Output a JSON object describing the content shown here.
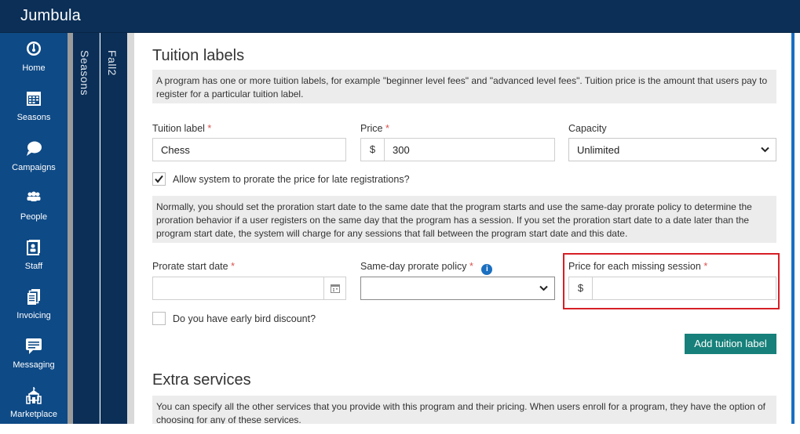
{
  "app": {
    "brand": "Jumbula"
  },
  "sidebar": {
    "items": [
      {
        "label": "Home",
        "icon": "gauge-icon"
      },
      {
        "label": "Seasons",
        "icon": "calendar-icon"
      },
      {
        "label": "Campaigns",
        "icon": "chat-bubble-icon"
      },
      {
        "label": "People",
        "icon": "people-icon"
      },
      {
        "label": "Staff",
        "icon": "staff-id-icon"
      },
      {
        "label": "Invoicing",
        "icon": "invoice-icon"
      },
      {
        "label": "Messaging",
        "icon": "message-icon"
      },
      {
        "label": "Marketplace",
        "icon": "marketplace-icon"
      }
    ]
  },
  "breadcrumb": {
    "level1": "Seasons",
    "level2": "Fall2"
  },
  "tuition": {
    "title": "Tuition labels",
    "description": "A program has one or more tuition labels, for example \"beginner level fees\" and \"advanced level fees\". Tuition price is the amount that users pay to register for a particular tuition label.",
    "label_field": {
      "label": "Tuition label",
      "required": "*",
      "value": "Chess"
    },
    "price_field": {
      "label": "Price",
      "required": "*",
      "prefix": "$",
      "value": "300"
    },
    "capacity_field": {
      "label": "Capacity",
      "value": "Unlimited"
    },
    "prorate_checkbox": {
      "label": "Allow system to prorate the price for late registrations?",
      "checked": true
    },
    "prorate_note": "Normally, you should set the proration start date to the same date that the program starts and use the same-day prorate policy to determine the proration behavior if a user registers on the same day that the program has a session. If you set the proration start date to a date later than the program start date, the system will charge for any sessions that fall between the program start date and this date.",
    "prorate_start": {
      "label": "Prorate start date",
      "required": "*",
      "value": ""
    },
    "same_day_policy": {
      "label": "Same-day prorate policy",
      "required": "*",
      "value": ""
    },
    "missing_session_price": {
      "label": "Price for each missing session",
      "required": "*",
      "prefix": "$",
      "value": ""
    },
    "early_bird": {
      "label": "Do you have early bird discount?",
      "checked": false
    },
    "add_button": "Add tuition label"
  },
  "extras": {
    "title": "Extra services",
    "description": "You can specify all the other services that you provide with this program and their pricing. When users enroll for a program, they have the option of choosing for any of these services."
  },
  "colors": {
    "topbar": "#0b2f57",
    "sidebar": "#0e4a86",
    "accent": "#17807a",
    "highlight": "#d61f26",
    "info": "#1b6fc0"
  }
}
